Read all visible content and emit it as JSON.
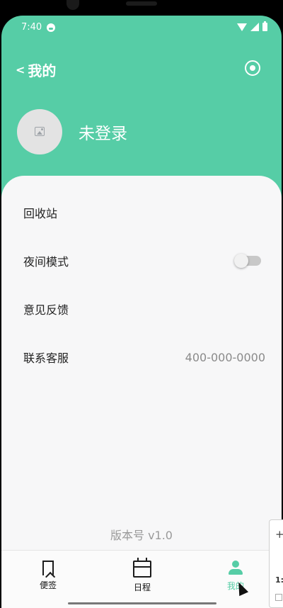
{
  "status_bar": {
    "time": "7:40"
  },
  "header": {
    "back_chevron": "<",
    "title": "我的",
    "settings_icon": "target-icon"
  },
  "profile": {
    "avatar_icon": "image-placeholder-icon",
    "name": "未登录"
  },
  "menu": {
    "items": [
      {
        "label": "回收站"
      },
      {
        "label": "夜间模式",
        "toggle_on": false
      },
      {
        "label": "意见反馈"
      },
      {
        "label": "联系客服",
        "value": "400-000-0000"
      }
    ]
  },
  "footer": {
    "version": "版本号 v1.0"
  },
  "bottom_nav": {
    "items": [
      {
        "label": "便签",
        "icon": "bookmark-icon"
      },
      {
        "label": "日程",
        "icon": "calendar-icon"
      },
      {
        "label": "我的",
        "icon": "person-icon",
        "active": true
      }
    ]
  },
  "overlay": {
    "panel_plus": "+",
    "panel_number": "1:"
  },
  "colors": {
    "accent": "#56cda6",
    "background": "#f7f7f8",
    "text": "#222222",
    "muted": "#8a8a8a"
  }
}
